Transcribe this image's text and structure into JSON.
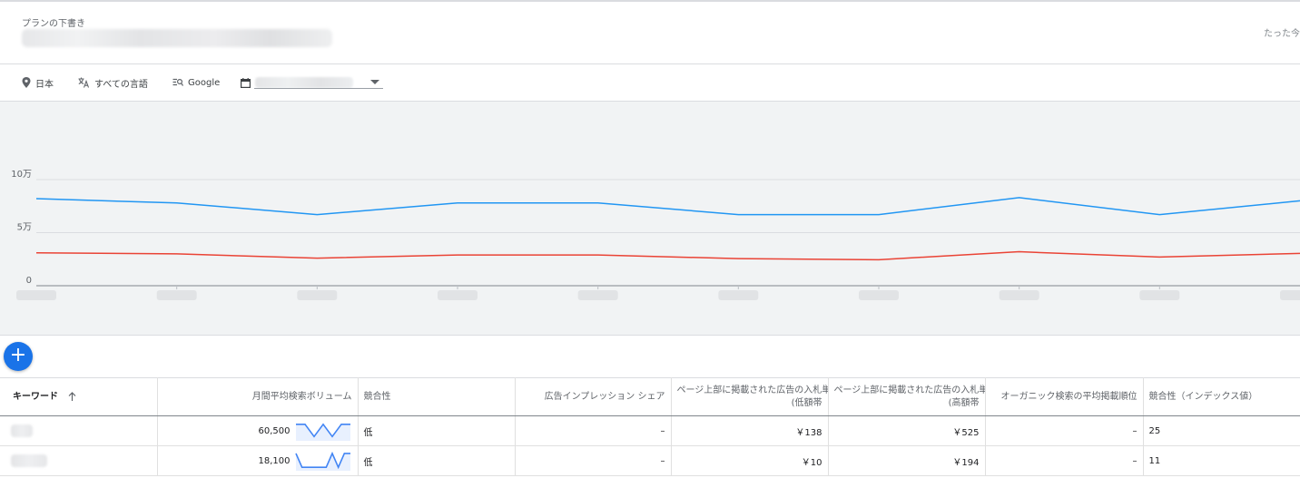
{
  "header": {
    "plan_label": "プランの下書き",
    "updated": "たった今"
  },
  "filters": {
    "location": "日本",
    "language": "すべての言語",
    "network": "Google"
  },
  "icons": {
    "location": "map-pin-icon",
    "language": "translate-icon",
    "network": "search-network-icon",
    "date": "calendar-icon",
    "dropdown": "arrow-drop-down-icon",
    "fab": "plus-icon",
    "sort": "arrow-up-icon"
  },
  "colors": {
    "series_volume": "#2196f3",
    "series_second": "#ea4335",
    "accent": "#1a73e8"
  },
  "chart_data": {
    "type": "line",
    "ytick_labels": [
      "0",
      "5万",
      "10万"
    ],
    "ylim": [
      0,
      100000
    ],
    "point_count": 10,
    "grid": true,
    "series": [
      {
        "values": [
          82000,
          78000,
          67000,
          78000,
          78000,
          67000,
          67000,
          83000,
          67000,
          80000
        ]
      },
      {
        "values": [
          31000,
          30000,
          26000,
          29000,
          29000,
          25500,
          24500,
          32000,
          27000,
          30500
        ]
      }
    ]
  },
  "fab": {
    "label": "+"
  },
  "table": {
    "headers": {
      "keyword": "キーワード",
      "volume": "月間平均検索ボリューム",
      "competition": "競合性",
      "impression_share": "広告インプレッション シェア",
      "bid_low": [
        "ページ上部に掲載された広告の入札単",
        "(低額帯"
      ],
      "bid_high": [
        "ページ上部に掲載された広告の入札単",
        "(高額帯"
      ],
      "organic_position": "オーガニック検索の平均掲載順位",
      "competition_index": "競合性（インデックス値）"
    },
    "rows": [
      {
        "volume": "60,500",
        "trend": [
          0.9,
          0.9,
          0.15,
          0.9,
          0.15,
          0.9,
          0.9
        ],
        "competition": "低",
        "impression_share": "–",
        "bid_low": "￥138",
        "bid_high": "￥525",
        "organic_position": "–",
        "competition_index": "25"
      },
      {
        "volume": "18,100",
        "trend": [
          0.95,
          0.1,
          0.1,
          0.1,
          0.1,
          0.1,
          0.95,
          0.1,
          0.95,
          0.95
        ],
        "competition": "低",
        "impression_share": "–",
        "bid_low": "￥10",
        "bid_high": "￥194",
        "organic_position": "–",
        "competition_index": "11"
      }
    ]
  }
}
